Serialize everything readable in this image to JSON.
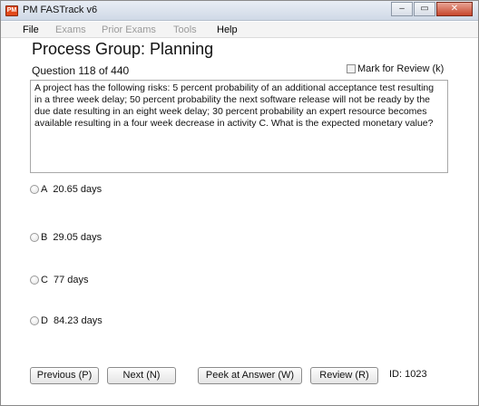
{
  "window": {
    "title": "PM FASTrack v6",
    "icon_text": "PM",
    "controls": {
      "minimize": "‒",
      "maximize": "▭",
      "close": "✕"
    }
  },
  "menu": {
    "items": [
      {
        "label": "File",
        "enabled": true
      },
      {
        "label": "Exams",
        "enabled": false
      },
      {
        "label": "Prior Exams",
        "enabled": false
      },
      {
        "label": "Tools",
        "enabled": false
      },
      {
        "label": "Help",
        "enabled": true
      }
    ]
  },
  "main": {
    "heading": "Process Group: Planning",
    "question_number": "Question 118 of 440",
    "mark_review_label": "Mark for Review (k)",
    "question_text": "A project has the following risks: 5 percent probability of an additional acceptance test resulting in a three week delay; 50 percent probability the next software release will not be ready by the due date resulting in an eight week delay; 30 percent probability an expert resource becomes available resulting in a four week decrease in activity C. What is the expected monetary value?",
    "options": [
      {
        "letter": "A",
        "text": "20.65 days"
      },
      {
        "letter": "B",
        "text": "29.05 days"
      },
      {
        "letter": "C",
        "text": "77 days"
      },
      {
        "letter": "D",
        "text": "84.23 days"
      }
    ]
  },
  "footer": {
    "previous_label": "Previous (P)",
    "next_label": "Next (N)",
    "peek_label": "Peek at Answer (W)",
    "review_label": "Review (R)",
    "id_text": "ID: 1023"
  }
}
